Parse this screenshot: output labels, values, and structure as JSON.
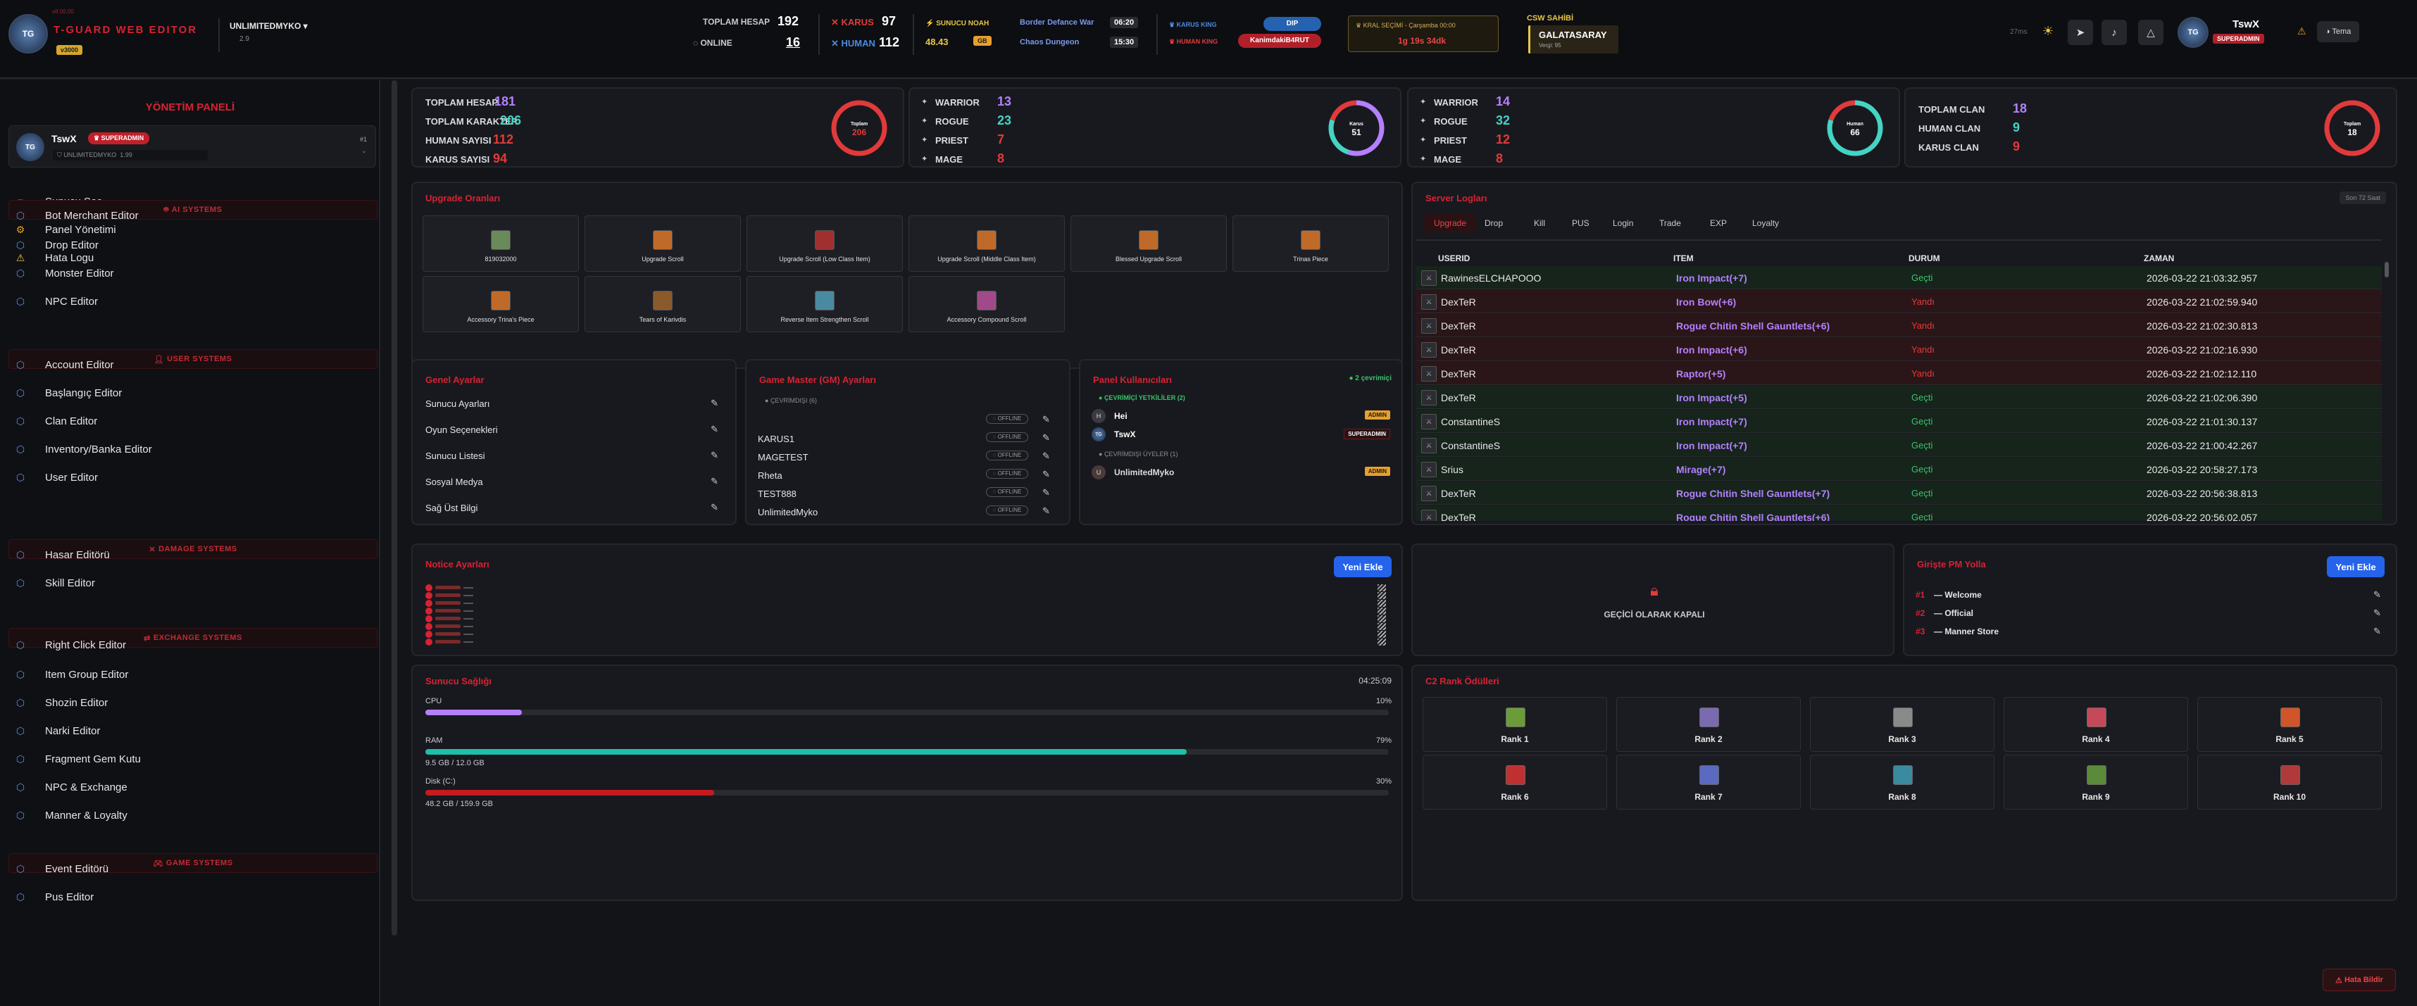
{
  "brand": {
    "version_small": "v8.00.00",
    "name": "T-GUARD WEB EDITOR",
    "badge": "v3000"
  },
  "header": {
    "server_user": "UNLIMITEDMYKO",
    "server_sub": "2.9",
    "toplam_hesap_label": "TOPLAM HESAP",
    "toplam_hesap": "192",
    "online_label": "ONLINE",
    "online": "16",
    "karus_label": "KARUS",
    "karus": "97",
    "human_label": "HUMAN",
    "human": "112",
    "sunucu_label": "SUNUCU NOAH",
    "sunucu_val": "48.43",
    "sunucu_badge": "GB",
    "event1": "Border Defance War",
    "event1_time": "06:20",
    "event2": "Chaos Dungeon",
    "event2_time": "15:30",
    "karus_king_label": "KARUS KING",
    "karus_king": "DIP",
    "human_king_label": "HUMAN KING",
    "human_king": "KanimdakiB4RUT",
    "kral_label": "KRAL SEÇİMİ - Çarşamba 00:00",
    "kral_timer": "1g 19s 34dk",
    "csw_label": "CSW SAHİBİ",
    "csw_owner": "GALATASARAY",
    "csw_sub": "Vergi: 95",
    "ping": "27ms",
    "user_name": "TswX",
    "user_badge": "SUPERADMIN",
    "tema": "Tema"
  },
  "sidebar": {
    "title": "YÖNETİM PANELİ",
    "profile": {
      "name": "TswX",
      "badge": "SUPERADMIN",
      "sub": "UNLIMITEDMYKO",
      "sub2": "1.99",
      "rank": "#1"
    },
    "top_items": [
      {
        "label": "Sunucu Seç",
        "icon": "server-icon"
      },
      {
        "label": "Panel Yönetimi",
        "icon": "gear-icon"
      },
      {
        "label": "Hata Logu",
        "icon": "warning-icon"
      }
    ],
    "sections": [
      {
        "title": "AI SYSTEMS",
        "items": [
          "Bot Merchant Editor",
          "Drop Editor",
          "Monster Editor",
          "NPC Editor"
        ]
      },
      {
        "title": "USER SYSTEMS",
        "items": [
          "Account Editor",
          "Başlangıç Editor",
          "Clan Editor",
          "Inventory/Banka Editor",
          "User Editor"
        ]
      },
      {
        "title": "DAMAGE SYSTEMS",
        "items": [
          "Hasar Editörü",
          "Skill Editor"
        ]
      },
      {
        "title": "EXCHANGE SYSTEMS",
        "items": [
          "Right Click Editor",
          "Item Group Editor",
          "Shozin Editor",
          "Narki Editor",
          "Fragment Gem Kutu",
          "NPC & Exchange",
          "Manner & Loyalty"
        ]
      },
      {
        "title": "GAME SYSTEMS",
        "items": [
          "Event Editörü",
          "Pus Editor"
        ]
      }
    ]
  },
  "stats": [
    {
      "rows": [
        {
          "label": "TOPLAM HESAP",
          "value": "181",
          "color": "#b480ff"
        },
        {
          "label": "TOPLAM KARAKTER",
          "value": "206",
          "color": "#43d4c4"
        },
        {
          "label": "HUMAN SAYISI",
          "value": "112",
          "color": "#e23a3a"
        },
        {
          "label": "KARUS SAYISI",
          "value": "94",
          "color": "#e23a3a"
        }
      ],
      "ring_label": "Toplam",
      "ring_value": "206",
      "ring_color": "#e23a3a"
    },
    {
      "rows": [
        {
          "label": "WARRIOR",
          "value": "13",
          "color": "#b480ff"
        },
        {
          "label": "ROGUE",
          "value": "23",
          "color": "#43d4c4"
        },
        {
          "label": "PRIEST",
          "value": "7",
          "color": "#e23a3a"
        },
        {
          "label": "MAGE",
          "value": "8",
          "color": "#e23a3a"
        }
      ],
      "ring_label": "Karus",
      "ring_value": "51",
      "ring_color": "#b480ff"
    },
    {
      "rows": [
        {
          "label": "WARRIOR",
          "value": "14",
          "color": "#b480ff"
        },
        {
          "label": "ROGUE",
          "value": "32",
          "color": "#43d4c4"
        },
        {
          "label": "PRIEST",
          "value": "12",
          "color": "#e23a3a"
        },
        {
          "label": "MAGE",
          "value": "8",
          "color": "#e23a3a"
        }
      ],
      "ring_label": "Human",
      "ring_value": "66",
      "ring_color": "#43d4c4"
    },
    {
      "rows": [
        {
          "label": "TOPLAM CLAN",
          "value": "18",
          "color": "#b480ff"
        },
        {
          "label": "HUMAN CLAN",
          "value": "9",
          "color": "#43d4c4"
        },
        {
          "label": "KARUS CLAN",
          "value": "9",
          "color": "#e23a3a"
        }
      ],
      "ring_label": "Toplam",
      "ring_value": "18",
      "ring_color": "#e23a3a"
    }
  ],
  "upgrade": {
    "title": "Upgrade Oranları",
    "items": [
      "819032000",
      "Upgrade Scroll",
      "Upgrade Scroll (Low Class Item)",
      "Upgrade Scroll (Middle Class Item)",
      "Blessed Upgrade Scroll",
      "Trinas Piece",
      "Accessory Trina's Piece",
      "Tears of Karivdis",
      "Reverse Item Strengthen Scroll",
      "Accessory Compound Scroll"
    ]
  },
  "logs": {
    "title": "Server Logları",
    "range": "Son 72 Saat",
    "tabs": [
      "Upgrade",
      "Drop",
      "Kill",
      "PUS",
      "Login",
      "Trade",
      "EXP",
      "Loyalty"
    ],
    "headers": [
      "USERID",
      "ITEM",
      "DURUM",
      "ZAMAN"
    ],
    "rows": [
      {
        "user": "RawinesELCHAPOOO",
        "item": "Iron Impact(+7)",
        "status": "Geçti",
        "time": "2026-03-22 21:03:32.957",
        "ok": true
      },
      {
        "user": "DexTeR",
        "item": "Iron Bow(+6)",
        "status": "Yandı",
        "time": "2026-03-22 21:02:59.940",
        "ok": false
      },
      {
        "user": "DexTeR",
        "item": "Rogue Chitin Shell Gauntlets(+6)",
        "status": "Yandı",
        "time": "2026-03-22 21:02:30.813",
        "ok": false
      },
      {
        "user": "DexTeR",
        "item": "Iron Impact(+6)",
        "status": "Yandı",
        "time": "2026-03-22 21:02:16.930",
        "ok": false
      },
      {
        "user": "DexTeR",
        "item": "Raptor(+5)",
        "status": "Yandı",
        "time": "2026-03-22 21:02:12.110",
        "ok": false
      },
      {
        "user": "DexTeR",
        "item": "Iron Impact(+5)",
        "status": "Geçti",
        "time": "2026-03-22 21:02:06.390",
        "ok": true
      },
      {
        "user": "ConstantineS",
        "item": "Iron Impact(+7)",
        "status": "Geçti",
        "time": "2026-03-22 21:01:30.137",
        "ok": true
      },
      {
        "user": "ConstantineS",
        "item": "Iron Impact(+7)",
        "status": "Geçti",
        "time": "2026-03-22 21:00:42.267",
        "ok": true
      },
      {
        "user": "Srius",
        "item": "Mirage(+7)",
        "status": "Geçti",
        "time": "2026-03-22 20:58:27.173",
        "ok": true
      },
      {
        "user": "DexTeR",
        "item": "Rogue Chitin Shell Gauntlets(+7)",
        "status": "Geçti",
        "time": "2026-03-22 20:56:38.813",
        "ok": true
      },
      {
        "user": "DexTeR",
        "item": "Rogue Chitin Shell Gauntlets(+6)",
        "status": "Geçti",
        "time": "2026-03-22 20:56:02.057",
        "ok": true
      }
    ]
  },
  "genel": {
    "title": "Genel Ayarlar",
    "items": [
      "Sunucu Ayarları",
      "Oyun Seçenekleri",
      "Sunucu Listesi",
      "Sosyal Medya",
      "Sağ Üst Bilgi"
    ]
  },
  "gm": {
    "title": "Game Master (GM) Ayarları",
    "section": "ÇEVRİMDIŞI (6)",
    "offline": "OFFLINE",
    "names": [
      "",
      "KARUS1",
      "MAGETEST",
      "Rheta",
      "TEST888",
      "UnlimitedMyko"
    ]
  },
  "panel_users": {
    "title": "Panel Kullanıcıları",
    "online_count": "2 çevrimiçi",
    "sec1": "ÇEVRİMİÇİ YETKİLİLER (2)",
    "sec2": "ÇEVRİMDIŞI ÜYELER (1)",
    "users": [
      {
        "name": "Hei",
        "role": "ADMIN"
      },
      {
        "name": "TswX",
        "role": "SUPERADMIN"
      },
      {
        "name": "UnlimitedMyko",
        "role": "ADMIN"
      }
    ]
  },
  "notice": {
    "title": "Notice Ayarları",
    "add": "Yeni Ekle"
  },
  "gecici": {
    "text": "GEÇİCİ OLARAK KAPALI"
  },
  "girisde": {
    "title": "Girişte PM Yolla",
    "add": "Yeni Ekle",
    "items": [
      {
        "no": "#1",
        "text": "— Welcome"
      },
      {
        "no": "#2",
        "text": "— Official"
      },
      {
        "no": "#3",
        "text": "— Manner Store"
      }
    ]
  },
  "health": {
    "title": "Sunucu Sağlığı",
    "time": "04:25:09",
    "rows": [
      {
        "label": "CPU",
        "pct": "10%",
        "sub": "",
        "fill": 0.1,
        "color": "#b480ff"
      },
      {
        "label": "RAM",
        "pct": "79%",
        "sub": "9.5 GB / 12.0 GB",
        "fill": 0.79,
        "color": "#1fbfa8"
      },
      {
        "label": "Disk (C:)",
        "pct": "30%",
        "sub": "48.2 GB / 159.9 GB",
        "fill": 0.3,
        "color": "#c41b22"
      }
    ]
  },
  "ranks": {
    "title": "C2 Rank Ödülleri",
    "items": [
      "Rank 1",
      "Rank 2",
      "Rank 3",
      "Rank 4",
      "Rank 5",
      "Rank 6",
      "Rank 7",
      "Rank 8",
      "Rank 9",
      "Rank 10"
    ],
    "colors": [
      "#6c9c3a",
      "#7a6bb0",
      "#8a8a8a",
      "#c44a5a",
      "#d0552a",
      "#c03030",
      "#5a6ac0",
      "#3a8aa0",
      "#5a8a3a",
      "#b03a3a"
    ]
  },
  "hata": "Hata Bildir"
}
